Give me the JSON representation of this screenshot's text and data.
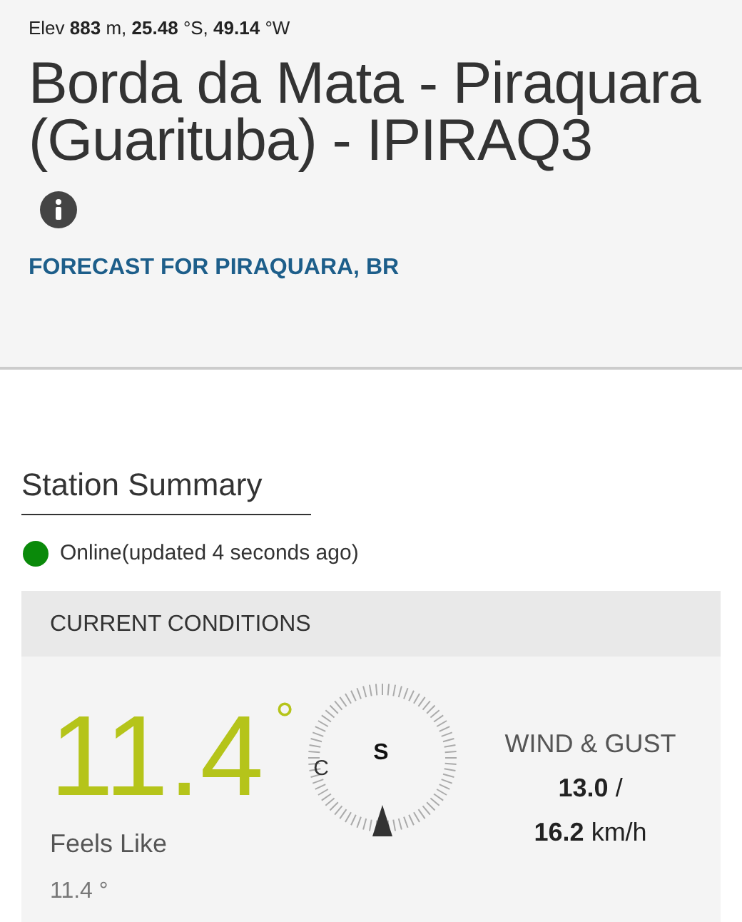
{
  "header": {
    "elevation": "Elev **883** m, **25.48** °S, **49.14** °W",
    "title": "Borda da Mata - Piraquara (Guarituba) - IPIRAQ3",
    "forecast_link": "FORECAST FOR PIRAQUARA, BR"
  },
  "summary": {
    "heading": "Station Summary",
    "online": true,
    "status": "Online(updated 4 seconds ago)"
  },
  "current": {
    "heading": "CURRENT CONDITIONS",
    "temperature": "11.4",
    "degree": "°",
    "feels_label": "Feels Like",
    "feels_value": "11.4 °",
    "compass": {
      "direction": "S",
      "partial_label": "C"
    },
    "wind_label": "WIND & GUST",
    "wind": "**13.0** /",
    "gust": "**16.2** km/h"
  }
}
